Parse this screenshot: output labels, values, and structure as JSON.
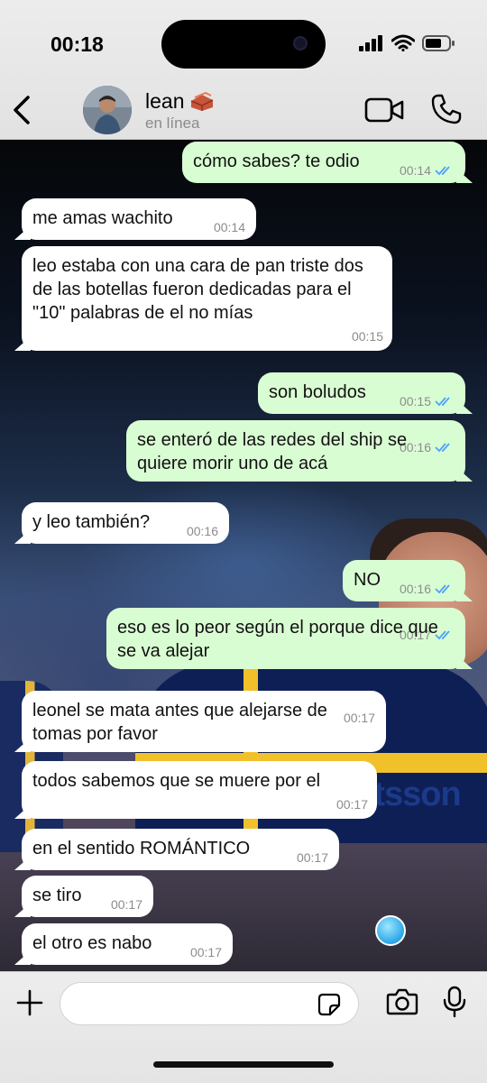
{
  "status_bar": {
    "time": "00:18"
  },
  "header": {
    "contact_name": "lean",
    "name_emoji": "brick-emoji",
    "contact_status": "en línea",
    "icons": [
      "chevron-left-icon",
      "video-camera-icon",
      "phone-icon"
    ]
  },
  "messages": [
    {
      "dir": "out",
      "text": "cómo sabes? te odio",
      "time": "00:14",
      "read": true
    },
    {
      "dir": "in",
      "text": "me amas wachito",
      "time": "00:14"
    },
    {
      "dir": "in",
      "text": "leo estaba con una cara de pan triste dos de las botellas fueron dedicadas para el \"10\" palabras de el no mías",
      "time": "00:15"
    },
    {
      "dir": "out",
      "text": "son boludos",
      "time": "00:15",
      "read": true
    },
    {
      "dir": "out",
      "text": "se enteró de las redes del ship se quiere morir uno de acá",
      "time": "00:16",
      "read": true
    },
    {
      "dir": "in",
      "text": "y leo también?",
      "time": "00:16"
    },
    {
      "dir": "out",
      "text": "NO",
      "time": "00:16",
      "read": true
    },
    {
      "dir": "out",
      "text": "eso es lo peor según el porque dice que se va alejar",
      "time": "00:17",
      "read": true
    },
    {
      "dir": "in",
      "text": "leonel se mata antes que alejarse de tomas por favor",
      "time": "00:17"
    },
    {
      "dir": "in",
      "text": "todos sabemos que se muere por el",
      "time": "00:17"
    },
    {
      "dir": "in",
      "text": "en el sentido ROMÁNTICO",
      "time": "00:17"
    },
    {
      "dir": "in",
      "text": "se tiro",
      "time": "00:17"
    },
    {
      "dir": "in",
      "text": "el otro es nabo",
      "time": "00:17"
    }
  ],
  "wallpaper": {
    "sponsor_text": "betsson"
  },
  "input_bar": {
    "placeholder": "",
    "icons": [
      "plus-icon",
      "sticker-icon",
      "camera-icon",
      "microphone-icon"
    ]
  },
  "colors": {
    "outgoing_bubble": "#d9fdd3",
    "incoming_bubble": "#ffffff",
    "read_ticks": "#4fa3f7",
    "header_bg": "#e8e8e8"
  }
}
